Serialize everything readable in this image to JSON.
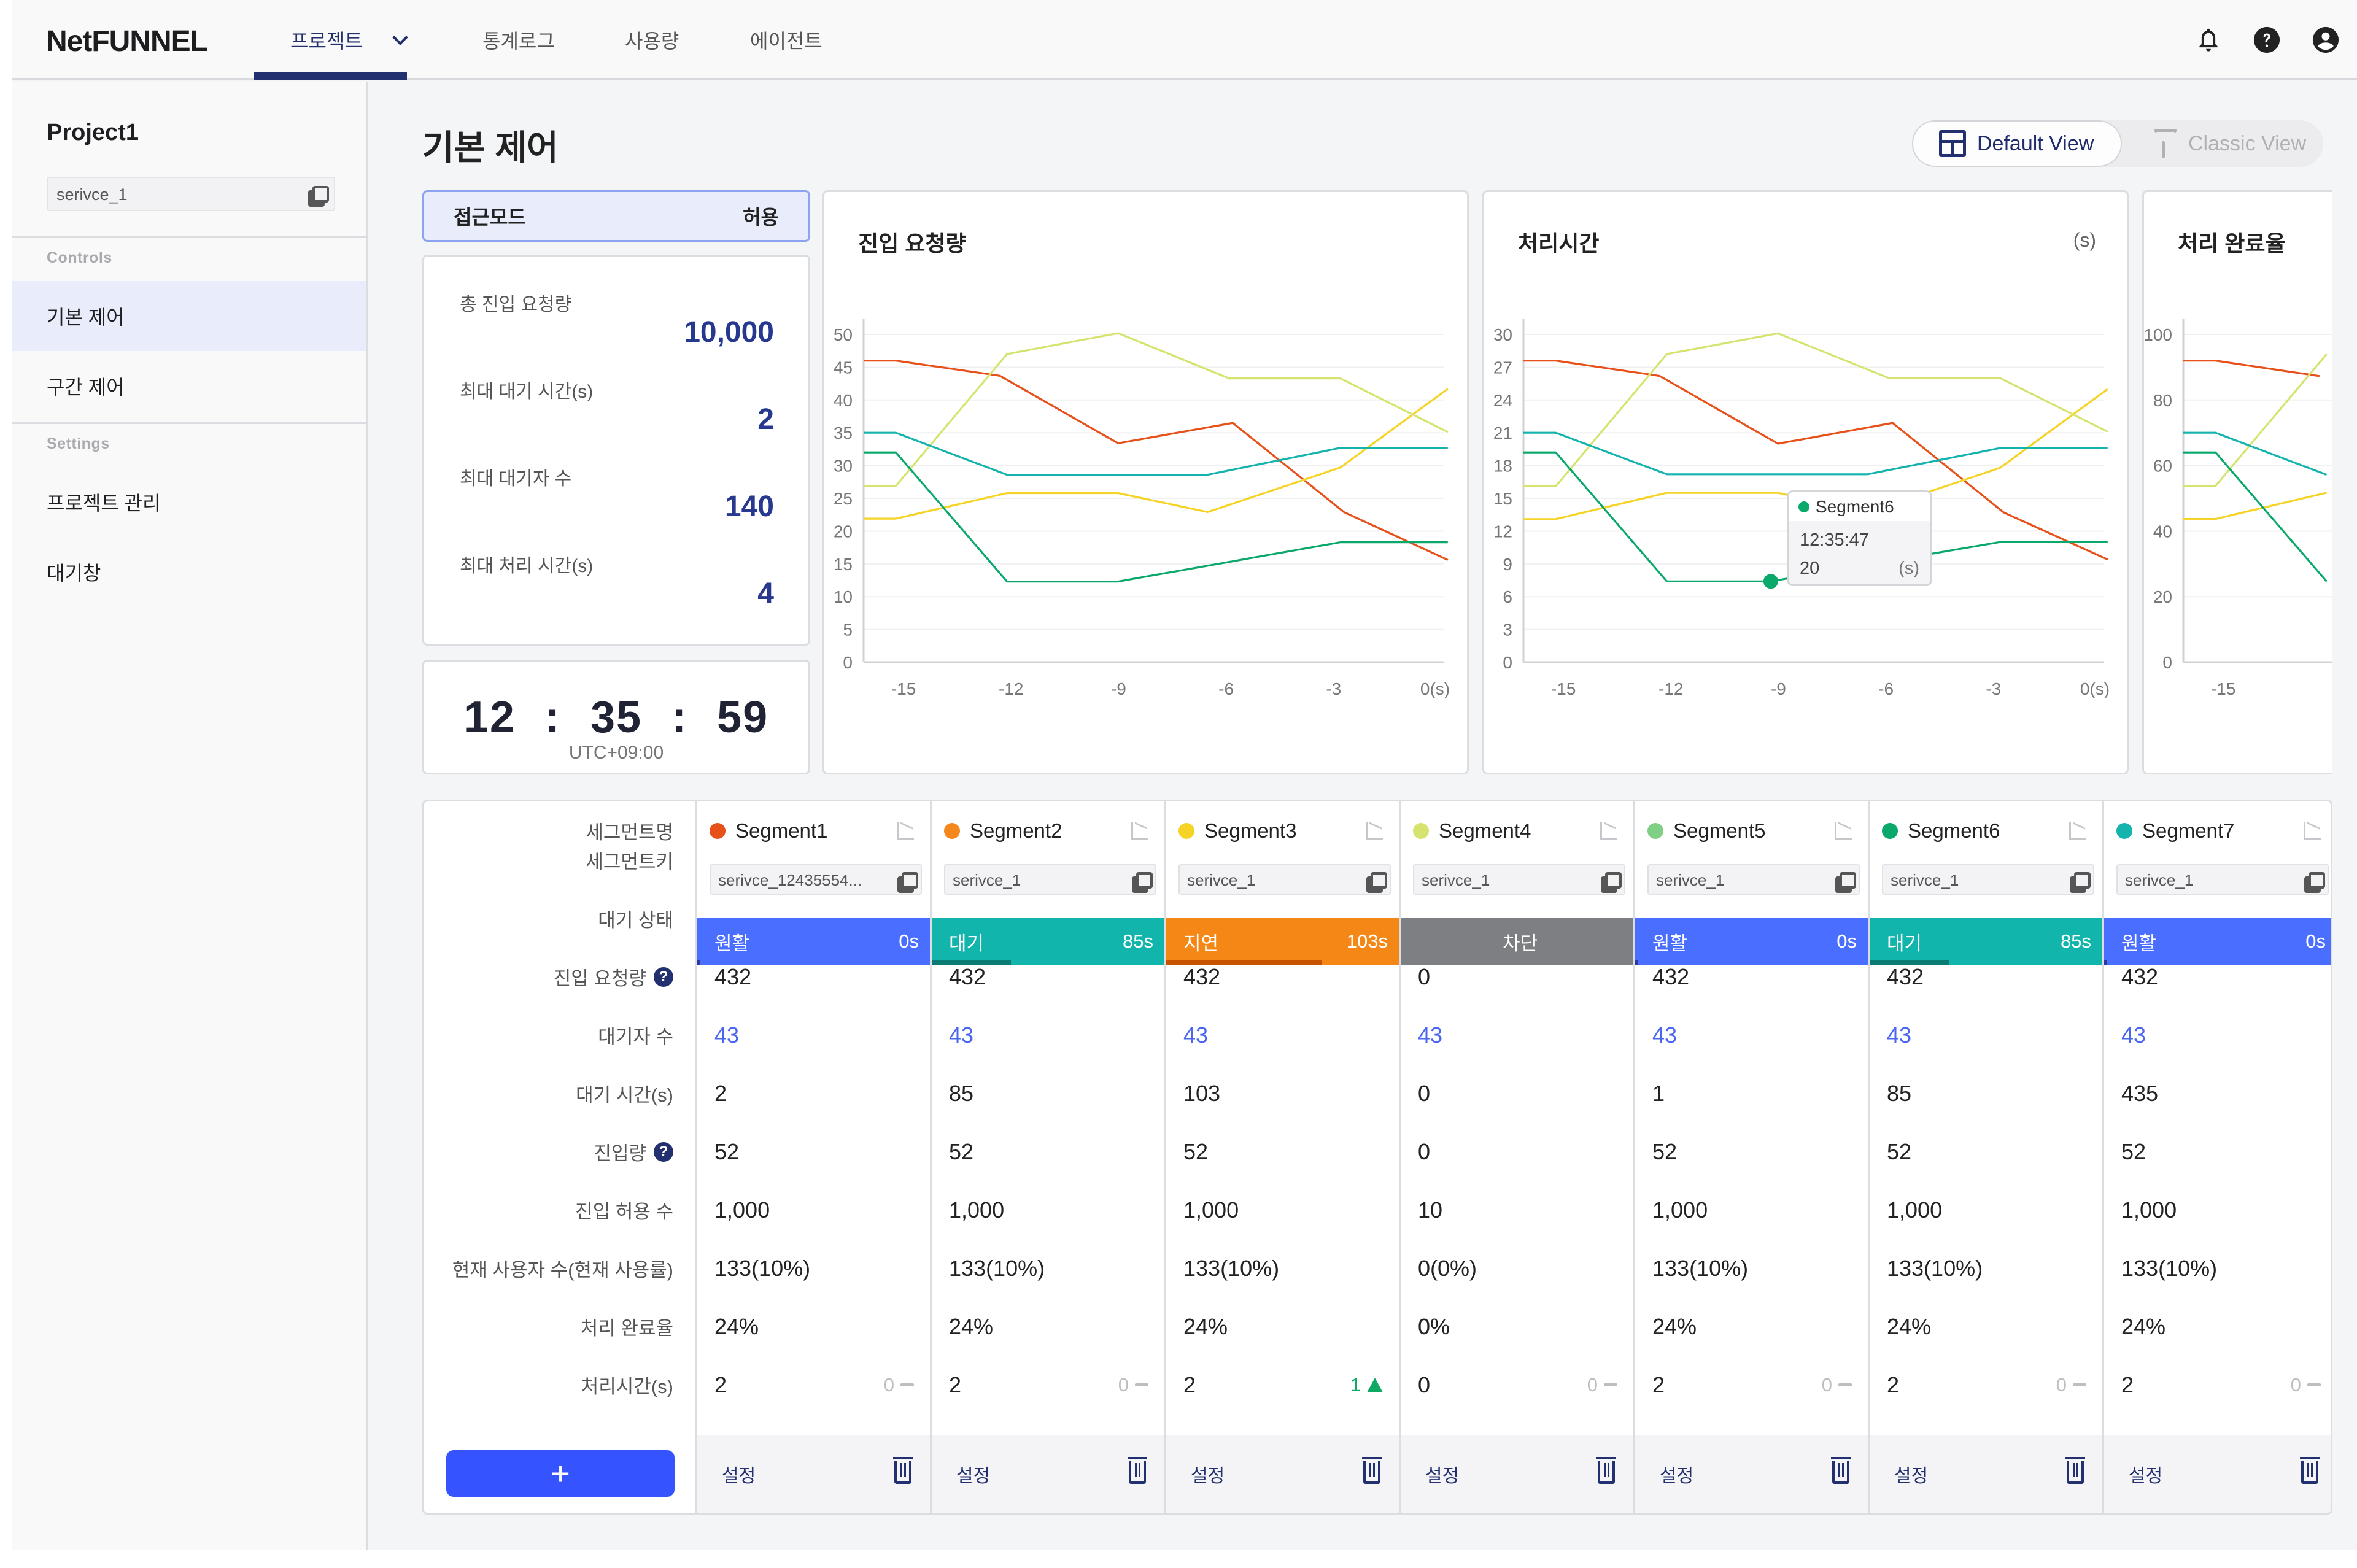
{
  "header": {
    "logo": "NetFUNNEL",
    "nav": [
      {
        "label": "프로젝트",
        "active": true,
        "has_dropdown": true
      },
      {
        "label": "통계로그",
        "active": false
      },
      {
        "label": "사용량",
        "active": false
      },
      {
        "label": "에이전트",
        "active": false
      }
    ],
    "icons": [
      "bell-icon",
      "help-icon",
      "account-icon"
    ]
  },
  "sidebar": {
    "project_name": "Project1",
    "service_key": "serivce_1",
    "sections": [
      {
        "title": "Controls",
        "items": [
          {
            "label": "기본 제어",
            "active": true
          },
          {
            "label": "구간 제어",
            "active": false
          }
        ]
      },
      {
        "title": "Settings",
        "items": [
          {
            "label": "프로젝트 관리",
            "active": false
          },
          {
            "label": "대기창",
            "active": false
          }
        ]
      }
    ]
  },
  "main": {
    "title": "기본 제어",
    "view_toggle": {
      "default_label": "Default View",
      "classic_label": "Classic View",
      "selected": "Default View"
    },
    "access_mode": {
      "label": "접근모드",
      "value": "허용"
    },
    "stats": [
      {
        "label": "총 진입 요청량",
        "value": "10,000"
      },
      {
        "label": "최대 대기 시간(s)",
        "value": "2"
      },
      {
        "label": "최대 대기자 수",
        "value": "140"
      },
      {
        "label": "최대 처리 시간(s)",
        "value": "4"
      }
    ],
    "clock": {
      "hh": "12",
      "mm": "35",
      "ss": "59",
      "sep": ":",
      "timezone": "UTC+09:00"
    },
    "tooltip": {
      "segment": "Segment6",
      "time": "12:35:47",
      "value": "20",
      "unit": "(s)"
    }
  },
  "colors": {
    "accent": "#22306f",
    "primary_button": "#3554ff",
    "status_smooth": "#4a6eff",
    "status_wait": "#12b5ab",
    "status_delay": "#f48716",
    "status_block": "#7e7f83"
  },
  "chart_data": [
    {
      "type": "line",
      "title": "진입 요청량",
      "unit": "",
      "xlabel": "",
      "ylabel": "",
      "x_ticks": [
        "-15",
        "-12",
        "-9",
        "-6",
        "-3",
        "0(s)"
      ],
      "y_ticks": [
        "0",
        "5",
        "10",
        "15",
        "20",
        "25",
        "30",
        "35",
        "40",
        "45",
        "50"
      ],
      "xlim": [
        -16.2,
        0
      ],
      "ylim": [
        0,
        50
      ],
      "grid": true,
      "series": [
        {
          "name": "Segment1",
          "color": "#e8501a",
          "x": [
            -16.2,
            -15.3,
            -12.4,
            -9.1,
            -5.9,
            -2.8,
            0.1
          ],
          "values": [
            46,
            46,
            43.7,
            33.4,
            36.5,
            22.9,
            15.6
          ]
        },
        {
          "name": "Segment3",
          "color": "#f5d327",
          "x": [
            -16.2,
            -15.3,
            -12.2,
            -9.1,
            -6.6,
            -2.9,
            0.1
          ],
          "values": [
            21.9,
            21.9,
            25.8,
            25.8,
            22.9,
            29.7,
            41.7
          ]
        },
        {
          "name": "Segment4",
          "color": "#d6e46f",
          "x": [
            -16.2,
            -15.3,
            -12.2,
            -9.1,
            -6.0,
            -2.9,
            0.1
          ],
          "values": [
            26.9,
            26.9,
            47,
            50.2,
            43.3,
            43.3,
            35.1
          ]
        },
        {
          "name": "Segment6",
          "color": "#0aa86b",
          "x": [
            -16.2,
            -15.3,
            -12.2,
            -9.1,
            -2.9,
            0.1
          ],
          "values": [
            32,
            32,
            12.3,
            12.3,
            18.3,
            18.3
          ]
        },
        {
          "name": "Segment7",
          "color": "#14b3ad",
          "x": [
            -16.2,
            -15.3,
            -12.2,
            -6.6,
            -2.9,
            0.1
          ],
          "values": [
            35,
            35,
            28.6,
            28.6,
            32.7,
            32.7
          ]
        }
      ]
    },
    {
      "type": "line",
      "title": "처리시간",
      "unit": "(s)",
      "xlabel": "",
      "ylabel": "",
      "x_ticks": [
        "-15",
        "-12",
        "-9",
        "-6",
        "-3",
        "0(s)"
      ],
      "y_ticks": [
        "0",
        "3",
        "6",
        "9",
        "12",
        "15",
        "18",
        "21",
        "24",
        "27",
        "30"
      ],
      "xlim": [
        -16.2,
        0
      ],
      "ylim": [
        0,
        30
      ],
      "grid": true,
      "highlight": {
        "series": "Segment6",
        "x": -9.3
      },
      "series": [
        {
          "name": "Segment1",
          "color": "#e8501a",
          "x": [
            -16.2,
            -15.3,
            -12.4,
            -9.1,
            -5.9,
            -2.8,
            0.1
          ],
          "values": [
            27.6,
            27.6,
            26.2,
            20.0,
            21.9,
            13.7,
            9.4
          ]
        },
        {
          "name": "Segment3",
          "color": "#f5d327",
          "x": [
            -16.2,
            -15.3,
            -12.2,
            -9.1,
            -6.6,
            -2.9,
            0.1
          ],
          "values": [
            13.1,
            13.1,
            15.5,
            15.5,
            13.7,
            17.8,
            25.0
          ]
        },
        {
          "name": "Segment4",
          "color": "#d6e46f",
          "x": [
            -16.2,
            -15.3,
            -12.2,
            -9.1,
            -6.0,
            -2.9,
            0.1
          ],
          "values": [
            16.1,
            16.1,
            28.2,
            30.1,
            26.0,
            26.0,
            21.1
          ]
        },
        {
          "name": "Segment6",
          "color": "#0aa86b",
          "x": [
            -16.2,
            -15.3,
            -12.2,
            -9.3,
            -2.9,
            0.1
          ],
          "values": [
            19.2,
            19.2,
            7.4,
            7.4,
            11.0,
            11.0
          ]
        },
        {
          "name": "Segment7",
          "color": "#14b3ad",
          "x": [
            -16.2,
            -15.3,
            -12.2,
            -6.6,
            -2.9,
            0.1
          ],
          "values": [
            21.0,
            21.0,
            17.2,
            17.2,
            19.6,
            19.6
          ]
        }
      ]
    },
    {
      "type": "line",
      "title": "처리 완료율",
      "unit": "",
      "xlabel": "",
      "ylabel": "",
      "x_ticks": [
        "-15"
      ],
      "y_ticks": [
        "0",
        "20",
        "40",
        "60",
        "80",
        "100"
      ],
      "xlim": [
        -16.2,
        0
      ],
      "ylim": [
        0,
        100
      ],
      "grid": true,
      "series": [
        {
          "name": "Segment1",
          "color": "#e8501a",
          "x": [
            -16.2,
            -15.3,
            -12.4
          ],
          "values": [
            92,
            92,
            87.3
          ]
        },
        {
          "name": "Segment3",
          "color": "#f5d327",
          "x": [
            -16.2,
            -15.3,
            -12.2
          ],
          "values": [
            43.7,
            43.7,
            51.7
          ]
        },
        {
          "name": "Segment4",
          "color": "#d6e46f",
          "x": [
            -16.2,
            -15.3,
            -12.2
          ],
          "values": [
            53.8,
            53.8,
            94
          ]
        },
        {
          "name": "Segment6",
          "color": "#0aa86b",
          "x": [
            -16.2,
            -15.3,
            -12.2
          ],
          "values": [
            64,
            64,
            24.6
          ]
        },
        {
          "name": "Segment7",
          "color": "#14b3ad",
          "x": [
            -16.2,
            -15.3,
            -12.2
          ],
          "values": [
            70,
            70,
            57.2
          ]
        }
      ]
    }
  ],
  "table": {
    "row_labels": [
      {
        "label": "세그먼트명",
        "help": false
      },
      {
        "label": "세그먼트키",
        "help": false
      },
      {
        "label": "대기 상태",
        "help": false
      },
      {
        "label": "진입 요청량",
        "help": true
      },
      {
        "label": "대기자 수",
        "help": false
      },
      {
        "label": "대기 시간(s)",
        "help": false
      },
      {
        "label": "진입량",
        "help": true
      },
      {
        "label": "진입 허용 수",
        "help": false
      },
      {
        "label": "현재 사용자 수(현재 사용률)",
        "help": false
      },
      {
        "label": "처리 완료율",
        "help": false
      },
      {
        "label": "처리시간(s)",
        "help": false
      }
    ],
    "add_button_label": "+",
    "settings_label": "설정",
    "segments": [
      {
        "name": "Segment1",
        "color": "#e8501a",
        "key": "serivce_12435554...",
        "status": "원활",
        "status_time": "0s",
        "status_color": "#4a6eff",
        "status_progress": 0.01,
        "status_progress_color": "#2a3a9f",
        "requests": "432",
        "waiting": "43",
        "wait_time": "2",
        "entries": "52",
        "allowed": "1,000",
        "current_users": "133(10%)",
        "completion": "24%",
        "proc_time": "2",
        "delta": "0",
        "delta_dir": "flat"
      },
      {
        "name": "Segment2",
        "color": "#f5871f",
        "key": "serivce_1",
        "status": "대기",
        "status_time": "85s",
        "status_color": "#12b5ab",
        "status_progress": 0.34,
        "status_progress_color": "#0a7c74",
        "requests": "432",
        "waiting": "43",
        "wait_time": "85",
        "entries": "52",
        "allowed": "1,000",
        "current_users": "133(10%)",
        "completion": "24%",
        "proc_time": "2",
        "delta": "0",
        "delta_dir": "flat"
      },
      {
        "name": "Segment3",
        "color": "#f5d327",
        "key": "serivce_1",
        "status": "지연",
        "status_time": "103s",
        "status_color": "#f48716",
        "status_progress": 0.67,
        "status_progress_color": "#c75200",
        "requests": "432",
        "waiting": "43",
        "wait_time": "103",
        "entries": "52",
        "allowed": "1,000",
        "current_users": "133(10%)",
        "completion": "24%",
        "proc_time": "2",
        "delta": "1",
        "delta_dir": "up"
      },
      {
        "name": "Segment4",
        "color": "#d6e46f",
        "key": "serivce_1",
        "status": "차단",
        "status_time": "",
        "status_color": "#7e7f83",
        "status_progress": 0,
        "status_progress_color": "#7e7f83",
        "requests": "0",
        "waiting": "43",
        "wait_time": "0",
        "entries": "0",
        "allowed": "10",
        "current_users": "0(0%)",
        "completion": "0%",
        "proc_time": "0",
        "delta": "0",
        "delta_dir": "flat"
      },
      {
        "name": "Segment5",
        "color": "#7fcf85",
        "key": "serivce_1",
        "status": "원활",
        "status_time": "0s",
        "status_color": "#4a6eff",
        "status_progress": 0.01,
        "status_progress_color": "#2a3a9f",
        "requests": "432",
        "waiting": "43",
        "wait_time": "1",
        "entries": "52",
        "allowed": "1,000",
        "current_users": "133(10%)",
        "completion": "24%",
        "proc_time": "2",
        "delta": "0",
        "delta_dir": "flat"
      },
      {
        "name": "Segment6",
        "color": "#0aa86b",
        "key": "serivce_1",
        "status": "대기",
        "status_time": "85s",
        "status_color": "#12b5ab",
        "status_progress": 0.34,
        "status_progress_color": "#0a7c74",
        "requests": "432",
        "waiting": "43",
        "wait_time": "85",
        "entries": "52",
        "allowed": "1,000",
        "current_users": "133(10%)",
        "completion": "24%",
        "proc_time": "2",
        "delta": "0",
        "delta_dir": "flat"
      },
      {
        "name": "Segment7",
        "color": "#14b3ad",
        "key": "serivce_1",
        "status": "원활",
        "status_time": "0s",
        "status_color": "#4a6eff",
        "status_progress": 0.01,
        "status_progress_color": "#2a3a9f",
        "requests": "432",
        "waiting": "43",
        "wait_time": "435",
        "entries": "52",
        "allowed": "1,000",
        "current_users": "133(10%)",
        "completion": "24%",
        "proc_time": "2",
        "delta": "0",
        "delta_dir": "flat"
      }
    ]
  }
}
